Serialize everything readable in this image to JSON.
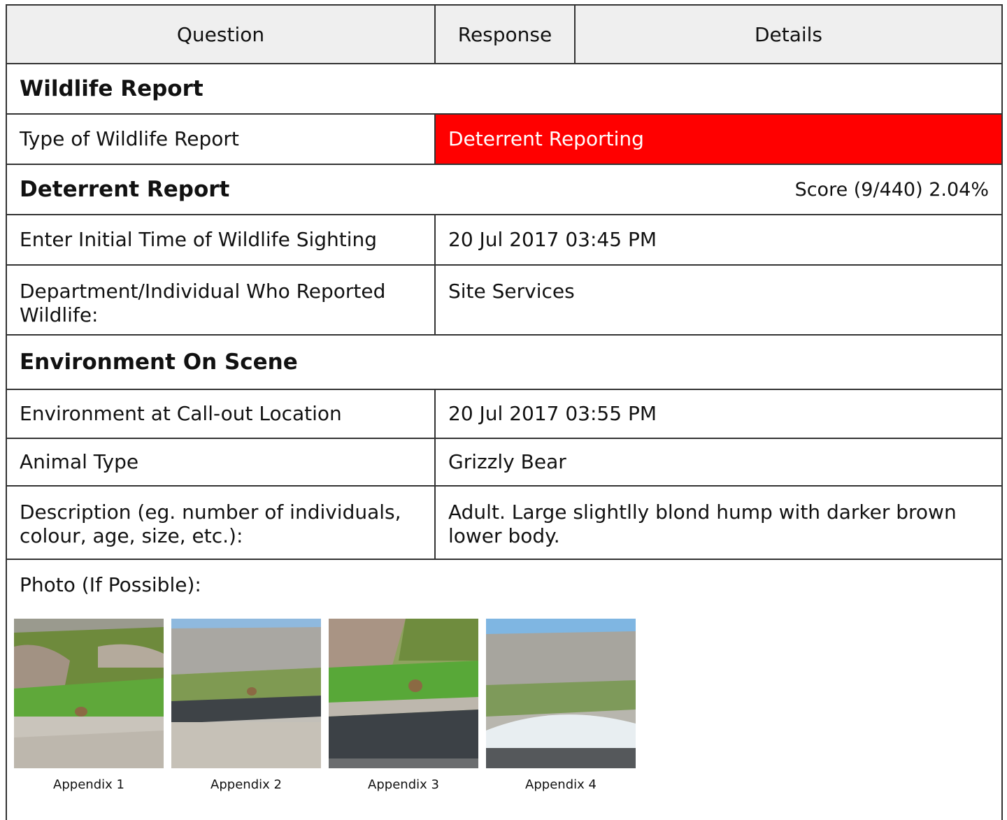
{
  "header": {
    "question": "Question",
    "response": "Response",
    "details": "Details"
  },
  "sections": {
    "wildlife_report": "Wildlife Report",
    "deterrent_report": "Deterrent Report",
    "deterrent_score": "Score (9/440) 2.04%",
    "environment": "Environment On Scene"
  },
  "rows": {
    "type_of_report": {
      "question": "Type of Wildlife Report",
      "response": "Deterrent Reporting",
      "response_bg": "#ff0000"
    },
    "initial_time": {
      "question": "Enter Initial Time of Wildlife Sighting",
      "response": "20 Jul 2017 03:45 PM"
    },
    "reporter": {
      "question": "Department/Individual Who Reported Wildlife:",
      "response": "Site Services"
    },
    "env_location": {
      "question": "Environment at Call-out Location",
      "response": "20 Jul 2017 03:55 PM"
    },
    "animal_type": {
      "question": "Animal Type",
      "response": "Grizzly Bear"
    },
    "description": {
      "question": "Description (eg. number of individuals, colour, age, size, etc.):",
      "response": "Adult. Large slightlly blond hump with darker brown lower body."
    }
  },
  "photo_block": {
    "label": "Photo (If Possible):",
    "captions": [
      "Appendix 1",
      "Appendix 2",
      "Appendix 3",
      "Appendix 4"
    ]
  }
}
